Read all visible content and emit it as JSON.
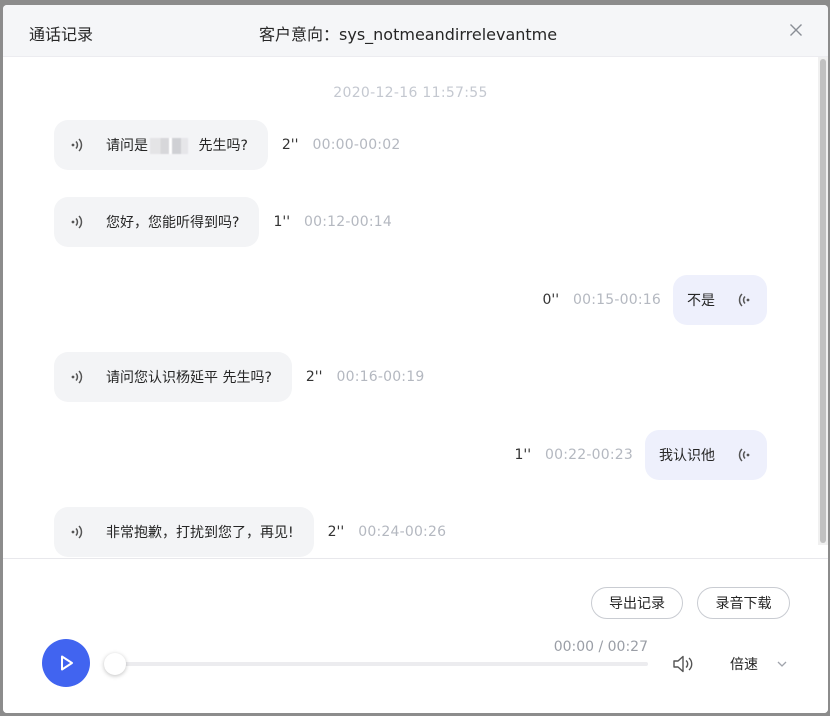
{
  "header": {
    "title": "通话记录",
    "intent_label": "客户意向：",
    "intent_value": "sys_notmeandirrelevantme"
  },
  "chat": {
    "timestamp": "2020-12-16 11:57:55",
    "messages": [
      {
        "side": "left",
        "text_before": "请问是",
        "text_after": " 先生吗?",
        "duration": "2''",
        "range": "00:00-00:02"
      },
      {
        "side": "left",
        "text": "您好，您能听得到吗?",
        "duration": "1''",
        "range": "00:12-00:14"
      },
      {
        "side": "right",
        "text": "不是",
        "duration": "0''",
        "range": "00:15-00:16"
      },
      {
        "side": "left",
        "text": "请问您认识杨延平 先生吗?",
        "duration": "2''",
        "range": "00:16-00:19"
      },
      {
        "side": "right",
        "text": "我认识他",
        "duration": "1''",
        "range": "00:22-00:23"
      },
      {
        "side": "left",
        "text": "非常抱歉，打扰到您了，再见!",
        "duration": "2''",
        "range": "00:24-00:26"
      }
    ]
  },
  "footer": {
    "export_label": "导出记录",
    "download_label": "录音下载",
    "time_display": "00:00 / 00:27",
    "speed_label": "倍速",
    "progress": 0
  },
  "icons": {
    "close": "close-icon",
    "speaker": "speaker-icon",
    "play": "play-icon",
    "volume": "volume-icon",
    "chevron": "chevron-down-icon"
  },
  "colors": {
    "accent": "#4164f0",
    "left_bubble": "#f3f4f6",
    "right_bubble": "#eef0fc"
  }
}
